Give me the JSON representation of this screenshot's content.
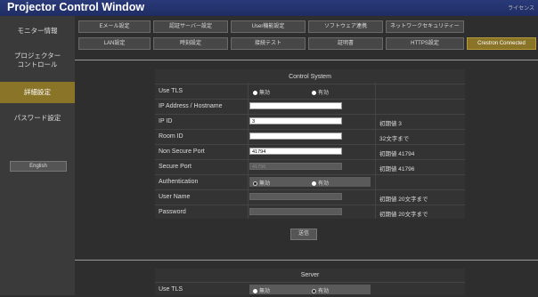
{
  "window": {
    "title": "Projector Control Window",
    "license_link": "ライセンス"
  },
  "sidebar": {
    "items": [
      {
        "label": "モニター情報"
      },
      {
        "label": "プロジェクター\nコントロール"
      },
      {
        "label": "詳細設定"
      },
      {
        "label": "パスワード設定"
      }
    ],
    "language_button": "English"
  },
  "tabs": [
    {
      "label": "Eメール設定"
    },
    {
      "label": "認証サーバー設定"
    },
    {
      "label": "User機能設定"
    },
    {
      "label": "ソフトウェア連携"
    },
    {
      "label": "ネットワークセキュリティー"
    },
    {
      "label": "LAN設定"
    },
    {
      "label": "時刻設定"
    },
    {
      "label": "接続テスト"
    },
    {
      "label": "証明書"
    },
    {
      "label": "HTTPS設定"
    },
    {
      "label": "Crestron Connected"
    }
  ],
  "control_system": {
    "title": "Control System",
    "use_tls": {
      "label": "Use TLS",
      "options": [
        "無効",
        "有効"
      ],
      "selected": "有効"
    },
    "ip_address": {
      "label": "IP Address / Hostname",
      "value": ""
    },
    "ip_id": {
      "label": "IP ID",
      "value": "3",
      "note": "初期値 3"
    },
    "room_id": {
      "label": "Room ID",
      "value": "",
      "note": "32文字まで"
    },
    "non_secure_port": {
      "label": "Non Secure Port",
      "value": "41794",
      "note": "初期値 41794"
    },
    "secure_port": {
      "label": "Secure Port",
      "value": "41796",
      "note": "初期値 41796"
    },
    "authentication": {
      "label": "Authentication",
      "options": [
        "無効",
        "有効"
      ],
      "selected": "有効"
    },
    "user_name": {
      "label": "User Name",
      "value": "",
      "note": "初期値 20文字まで"
    },
    "password": {
      "label": "Password",
      "value": "",
      "note": "初期値 20文字まで"
    },
    "submit": "送信"
  },
  "server": {
    "title": "Server",
    "use_tls": {
      "label": "Use TLS",
      "options": [
        "無効",
        "有効"
      ],
      "selected": "無効"
    }
  },
  "colors": {
    "accent": "#8a7428",
    "titlebar": "#1f2d63",
    "background": "#2e2e2e"
  }
}
